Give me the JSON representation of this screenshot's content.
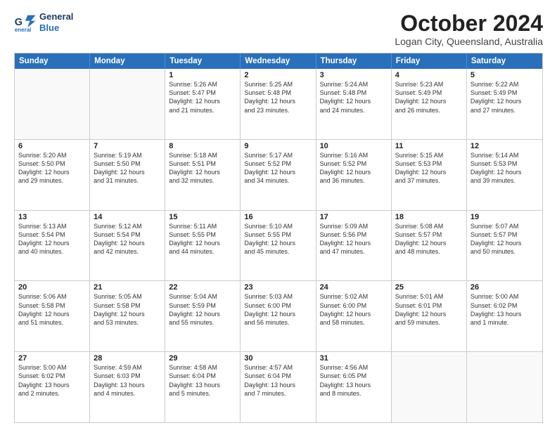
{
  "logo": {
    "line1": "General",
    "line2": "Blue"
  },
  "title": "October 2024",
  "subtitle": "Logan City, Queensland, Australia",
  "dayHeaders": [
    "Sunday",
    "Monday",
    "Tuesday",
    "Wednesday",
    "Thursday",
    "Friday",
    "Saturday"
  ],
  "weeks": [
    [
      {
        "date": "",
        "info": ""
      },
      {
        "date": "",
        "info": ""
      },
      {
        "date": "1",
        "info": "Sunrise: 5:26 AM\nSunset: 5:47 PM\nDaylight: 12 hours\nand 21 minutes."
      },
      {
        "date": "2",
        "info": "Sunrise: 5:25 AM\nSunset: 5:48 PM\nDaylight: 12 hours\nand 23 minutes."
      },
      {
        "date": "3",
        "info": "Sunrise: 5:24 AM\nSunset: 5:48 PM\nDaylight: 12 hours\nand 24 minutes."
      },
      {
        "date": "4",
        "info": "Sunrise: 5:23 AM\nSunset: 5:49 PM\nDaylight: 12 hours\nand 26 minutes."
      },
      {
        "date": "5",
        "info": "Sunrise: 5:22 AM\nSunset: 5:49 PM\nDaylight: 12 hours\nand 27 minutes."
      }
    ],
    [
      {
        "date": "6",
        "info": "Sunrise: 5:20 AM\nSunset: 5:50 PM\nDaylight: 12 hours\nand 29 minutes."
      },
      {
        "date": "7",
        "info": "Sunrise: 5:19 AM\nSunset: 5:50 PM\nDaylight: 12 hours\nand 31 minutes."
      },
      {
        "date": "8",
        "info": "Sunrise: 5:18 AM\nSunset: 5:51 PM\nDaylight: 12 hours\nand 32 minutes."
      },
      {
        "date": "9",
        "info": "Sunrise: 5:17 AM\nSunset: 5:52 PM\nDaylight: 12 hours\nand 34 minutes."
      },
      {
        "date": "10",
        "info": "Sunrise: 5:16 AM\nSunset: 5:52 PM\nDaylight: 12 hours\nand 36 minutes."
      },
      {
        "date": "11",
        "info": "Sunrise: 5:15 AM\nSunset: 5:53 PM\nDaylight: 12 hours\nand 37 minutes."
      },
      {
        "date": "12",
        "info": "Sunrise: 5:14 AM\nSunset: 5:53 PM\nDaylight: 12 hours\nand 39 minutes."
      }
    ],
    [
      {
        "date": "13",
        "info": "Sunrise: 5:13 AM\nSunset: 5:54 PM\nDaylight: 12 hours\nand 40 minutes."
      },
      {
        "date": "14",
        "info": "Sunrise: 5:12 AM\nSunset: 5:54 PM\nDaylight: 12 hours\nand 42 minutes."
      },
      {
        "date": "15",
        "info": "Sunrise: 5:11 AM\nSunset: 5:55 PM\nDaylight: 12 hours\nand 44 minutes."
      },
      {
        "date": "16",
        "info": "Sunrise: 5:10 AM\nSunset: 5:55 PM\nDaylight: 12 hours\nand 45 minutes."
      },
      {
        "date": "17",
        "info": "Sunrise: 5:09 AM\nSunset: 5:56 PM\nDaylight: 12 hours\nand 47 minutes."
      },
      {
        "date": "18",
        "info": "Sunrise: 5:08 AM\nSunset: 5:57 PM\nDaylight: 12 hours\nand 48 minutes."
      },
      {
        "date": "19",
        "info": "Sunrise: 5:07 AM\nSunset: 5:57 PM\nDaylight: 12 hours\nand 50 minutes."
      }
    ],
    [
      {
        "date": "20",
        "info": "Sunrise: 5:06 AM\nSunset: 5:58 PM\nDaylight: 12 hours\nand 51 minutes."
      },
      {
        "date": "21",
        "info": "Sunrise: 5:05 AM\nSunset: 5:58 PM\nDaylight: 12 hours\nand 53 minutes."
      },
      {
        "date": "22",
        "info": "Sunrise: 5:04 AM\nSunset: 5:59 PM\nDaylight: 12 hours\nand 55 minutes."
      },
      {
        "date": "23",
        "info": "Sunrise: 5:03 AM\nSunset: 6:00 PM\nDaylight: 12 hours\nand 56 minutes."
      },
      {
        "date": "24",
        "info": "Sunrise: 5:02 AM\nSunset: 6:00 PM\nDaylight: 12 hours\nand 58 minutes."
      },
      {
        "date": "25",
        "info": "Sunrise: 5:01 AM\nSunset: 6:01 PM\nDaylight: 12 hours\nand 59 minutes."
      },
      {
        "date": "26",
        "info": "Sunrise: 5:00 AM\nSunset: 6:02 PM\nDaylight: 13 hours\nand 1 minute."
      }
    ],
    [
      {
        "date": "27",
        "info": "Sunrise: 5:00 AM\nSunset: 6:02 PM\nDaylight: 13 hours\nand 2 minutes."
      },
      {
        "date": "28",
        "info": "Sunrise: 4:59 AM\nSunset: 6:03 PM\nDaylight: 13 hours\nand 4 minutes."
      },
      {
        "date": "29",
        "info": "Sunrise: 4:58 AM\nSunset: 6:04 PM\nDaylight: 13 hours\nand 5 minutes."
      },
      {
        "date": "30",
        "info": "Sunrise: 4:57 AM\nSunset: 6:04 PM\nDaylight: 13 hours\nand 7 minutes."
      },
      {
        "date": "31",
        "info": "Sunrise: 4:56 AM\nSunset: 6:05 PM\nDaylight: 13 hours\nand 8 minutes."
      },
      {
        "date": "",
        "info": ""
      },
      {
        "date": "",
        "info": ""
      }
    ]
  ]
}
